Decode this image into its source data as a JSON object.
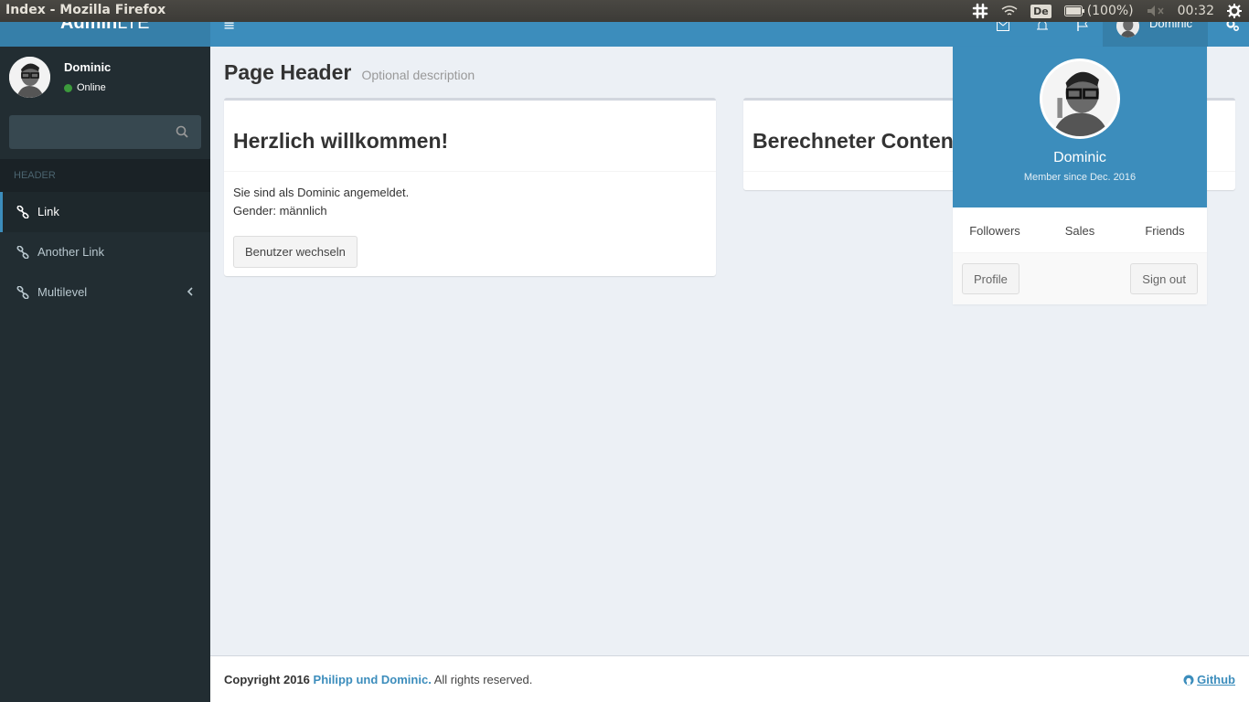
{
  "os": {
    "window_title": "Index - Mozilla Firefox",
    "keyboard_layout": "De",
    "battery": "(100%)",
    "time": "00:32"
  },
  "brand": {
    "bold": "Admin",
    "light": "LTE"
  },
  "sidebar": {
    "user_name": "Dominic",
    "user_status": "Online",
    "search_placeholder": "",
    "menu_header": "HEADER",
    "items": [
      {
        "label": "Link",
        "icon": "link-icon",
        "active": true
      },
      {
        "label": "Another Link",
        "icon": "link-icon",
        "active": false
      },
      {
        "label": "Multilevel",
        "icon": "link-icon",
        "active": false,
        "has_children": true
      }
    ]
  },
  "header": {
    "menu_toggle": "≡",
    "user_name": "Dominic"
  },
  "content": {
    "title": "Page Header",
    "description": "Optional description",
    "welcome_box": {
      "title": "Herzlich willkommen!",
      "line1": "Sie sind als Dominic angemeldet.",
      "line2": "Gender: männlich",
      "button": "Benutzer wechseln"
    },
    "computed_box": {
      "title": "Berechneter Content"
    }
  },
  "user_dropdown": {
    "name": "Dominic",
    "member_since": "Member since Dec. 2016",
    "links": [
      "Followers",
      "Sales",
      "Friends"
    ],
    "profile_button": "Profile",
    "signout_button": "Sign out"
  },
  "footer": {
    "copyright_prefix": "Copyright 2016",
    "authors": "Philipp und Dominic.",
    "rights": "All rights reserved.",
    "github": "Github"
  },
  "colors": {
    "primary": "#3c8dbc",
    "sidebar": "#222d32",
    "content_bg": "#ecf0f5"
  }
}
